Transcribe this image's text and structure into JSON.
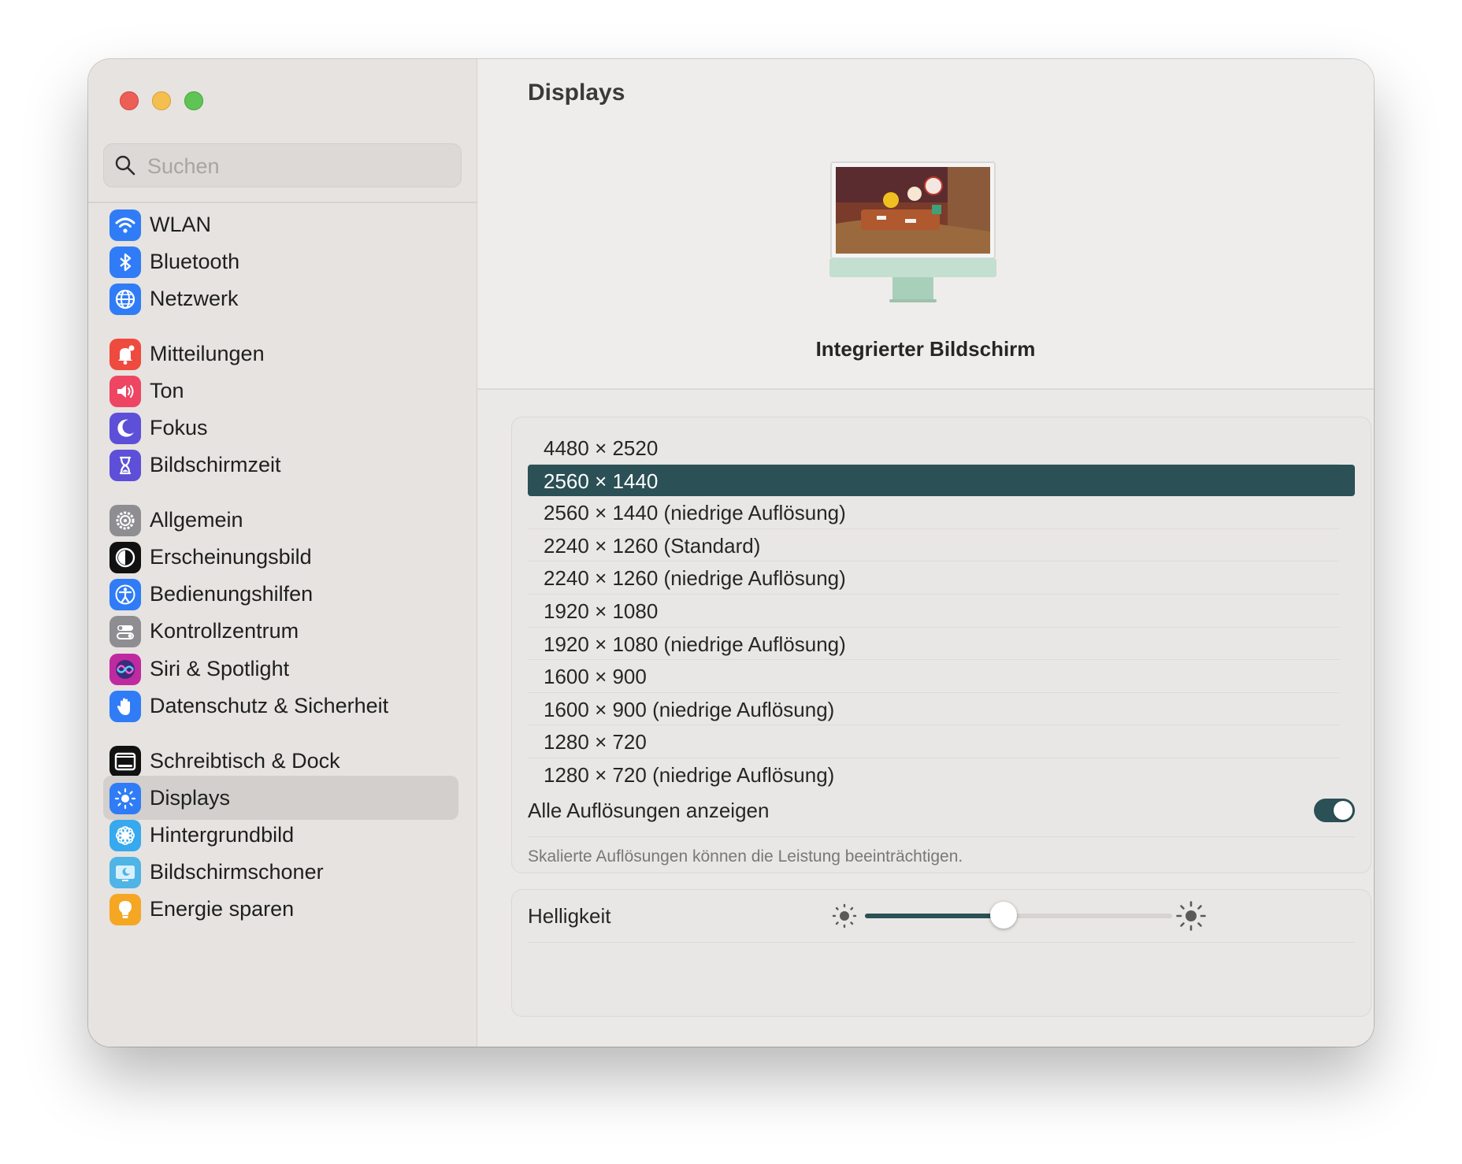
{
  "window": {
    "traffic_lights": [
      "close",
      "minimize",
      "zoom"
    ]
  },
  "search": {
    "placeholder": "Suchen",
    "value": ""
  },
  "sidebar": {
    "items": [
      {
        "label": "WLAN",
        "icon": "wifi-icon",
        "color": "#2f7cf6"
      },
      {
        "label": "Bluetooth",
        "icon": "bluetooth-icon",
        "color": "#2f7cf6"
      },
      {
        "label": "Netzwerk",
        "icon": "globe-icon",
        "color": "#2f7cf6"
      },
      {
        "label": "Mitteilungen",
        "icon": "bell-icon",
        "color": "#ee4a3e"
      },
      {
        "label": "Ton",
        "icon": "speaker-icon",
        "color": "#ee4662"
      },
      {
        "label": "Fokus",
        "icon": "moon-icon",
        "color": "#5d4fd8"
      },
      {
        "label": "Bildschirmzeit",
        "icon": "hourglass-icon",
        "color": "#5d4fd8"
      },
      {
        "label": "Allgemein",
        "icon": "gear-icon",
        "color": "#8e8e92"
      },
      {
        "label": "Erscheinungsbild",
        "icon": "appearance-icon",
        "color": "#111111"
      },
      {
        "label": "Bedienungshilfen",
        "icon": "accessibility-icon",
        "color": "#2f7cf6"
      },
      {
        "label": "Kontrollzentrum",
        "icon": "control-center-icon",
        "color": "#8e8e92"
      },
      {
        "label": "Siri & Spotlight",
        "icon": "siri-icon",
        "color": "#c02aa0"
      },
      {
        "label": "Datenschutz & Sicherheit",
        "icon": "hand-icon",
        "color": "#2f7cf6"
      },
      {
        "label": "Schreibtisch & Dock",
        "icon": "dock-icon",
        "color": "#111111"
      },
      {
        "label": "Displays",
        "icon": "brightness-icon",
        "color": "#2f7cf6"
      },
      {
        "label": "Hintergrundbild",
        "icon": "flower-icon",
        "color": "#36a9ef"
      },
      {
        "label": "Bildschirmschoner",
        "icon": "screensaver-icon",
        "color": "#4fb4e6"
      },
      {
        "label": "Energie sparen",
        "icon": "bulb-icon",
        "color": "#f5a623"
      }
    ],
    "selected": "Displays"
  },
  "main": {
    "title": "Displays",
    "display_name": "Integrierter Bildschirm",
    "resolutions": [
      "4480 × 2520",
      "2560 × 1440",
      "2560 × 1440 (niedrige Auflösung)",
      "2240 × 1260 (Standard)",
      "2240 × 1260 (niedrige Auflösung)",
      "1920 × 1080",
      "1920 × 1080 (niedrige Auflösung)",
      "1600 × 900",
      "1600 × 900 (niedrige Auflösung)",
      "1280 × 720",
      "1280 × 720 (niedrige Auflösung)"
    ],
    "selected_resolution": "2560 × 1440",
    "show_all_label": "Alle Auflösungen anzeigen",
    "show_all_enabled": true,
    "hint": "Skalierte Auflösungen können die Leistung beeinträchtigen.",
    "brightness_label": "Helligkeit",
    "brightness_level": 0.45,
    "accent_color": "#2b5055"
  }
}
